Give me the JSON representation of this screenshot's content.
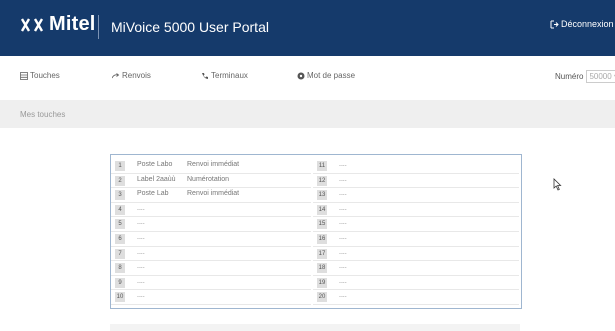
{
  "header": {
    "brand": "Mitel",
    "title": "MiVoice 5000 User Portal",
    "logout_label": "Déconnexion"
  },
  "nav": {
    "items": [
      {
        "label": "Touches",
        "icon": "keypad-icon"
      },
      {
        "label": "Renvois",
        "icon": "forward-arrow-icon"
      },
      {
        "label": "Terminaux",
        "icon": "phone-icon"
      },
      {
        "label": "Mot de passe",
        "icon": "gear-icon"
      }
    ],
    "numero_label": "Numéro",
    "numero_value": "50000"
  },
  "section": {
    "title": "Mes touches"
  },
  "keys": {
    "left": [
      {
        "num": "1",
        "label": "Poste Labo",
        "func": "Renvoi immédiat"
      },
      {
        "num": "2",
        "label": "Label 2aaùù",
        "func": "Numérotation"
      },
      {
        "num": "3",
        "label": "Poste Lab",
        "func": "Renvoi immédiat"
      },
      {
        "num": "4",
        "label": "....",
        "func": ""
      },
      {
        "num": "5",
        "label": "....",
        "func": ""
      },
      {
        "num": "6",
        "label": "....",
        "func": ""
      },
      {
        "num": "7",
        "label": "....",
        "func": ""
      },
      {
        "num": "8",
        "label": "....",
        "func": ""
      },
      {
        "num": "9",
        "label": "....",
        "func": ""
      },
      {
        "num": "10",
        "label": "....",
        "func": ""
      }
    ],
    "right": [
      {
        "num": "11",
        "label": "....",
        "func": ""
      },
      {
        "num": "12",
        "label": "....",
        "func": ""
      },
      {
        "num": "13",
        "label": "....",
        "func": ""
      },
      {
        "num": "14",
        "label": "....",
        "func": ""
      },
      {
        "num": "15",
        "label": "....",
        "func": ""
      },
      {
        "num": "16",
        "label": "....",
        "func": ""
      },
      {
        "num": "17",
        "label": "....",
        "func": ""
      },
      {
        "num": "18",
        "label": "....",
        "func": ""
      },
      {
        "num": "19",
        "label": "....",
        "func": ""
      },
      {
        "num": "20",
        "label": "....",
        "func": ""
      }
    ]
  },
  "colors": {
    "header_bg": "#153a6b",
    "grid_border": "#9fb6d0",
    "section_bg": "#efefef"
  }
}
